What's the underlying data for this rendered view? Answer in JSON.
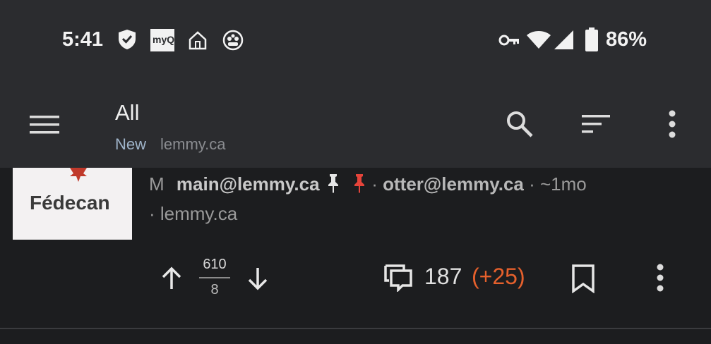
{
  "status_bar": {
    "time": "5:41",
    "battery": "86%",
    "notification_icons": [
      "shield-check-icon",
      "myq-app-icon",
      "smart-home-icon",
      "game-controller-icon"
    ],
    "system_icons": [
      "vpn-key-icon",
      "wifi-icon",
      "cell-signal-icon",
      "battery-icon"
    ],
    "myq_label": "myQ"
  },
  "app_bar": {
    "title": "All",
    "sort": "New",
    "instance": "lemmy.ca"
  },
  "post": {
    "thumbnail_text": "Fédecan",
    "flag": "M",
    "community": "main@lemmy.ca",
    "separator1": " · ",
    "author": "otter@lemmy.ca",
    "age": " · ~1mo",
    "domain": "· lemmy.ca",
    "upvotes": "610",
    "downvotes": "8",
    "comments": "187",
    "new_comments": "(+25)"
  },
  "colors": {
    "background": "#1c1d1f",
    "bar": "#2b2c2f",
    "accent_orange": "#e5602c",
    "pin_red": "#e5443a"
  }
}
